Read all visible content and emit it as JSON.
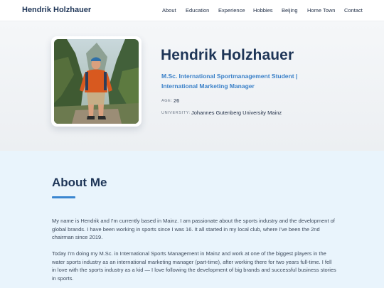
{
  "nav": {
    "brand": "Hendrik Holzhauer",
    "links": [
      "About",
      "Education",
      "Experience",
      "Hobbies",
      "Beijing",
      "Home Town",
      "Contact"
    ]
  },
  "hero": {
    "name": "Hendrik Holzhauer",
    "subtitle": "M.Sc. International Sportmanagement Student | International Marketing Manager",
    "age_label": "AGE:",
    "age_value": "26",
    "university_label": "UNIVERSITY:",
    "university_value": "Johannes Gutenberg University Mainz"
  },
  "about": {
    "title": "About Me",
    "paragraphs": [
      "My name is Hendrik and I'm currently based in Mainz. I am passionate about the sports industry and the development of global brands. I have been working in sports since I was 16. It all started in my local club, where I've been the 2nd chairman since 2019.",
      "Today I'm doing my M.Sc. in International Sports Management in Mainz and work at one of the biggest players in the water sports industry as an international marketing manager (part-time), after working there for two years full-time. I fell in love with the sports industry as a kid — I love following the development of big brands and successful business stories in sports."
    ]
  },
  "colors": {
    "brand_navy": "#1e3557",
    "accent_blue": "#3a80c8",
    "about_bg": "#e9f4fc"
  }
}
